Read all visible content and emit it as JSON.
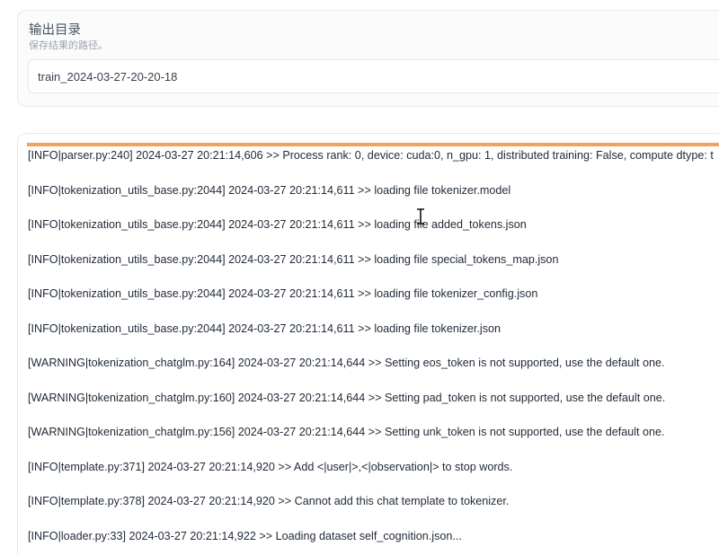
{
  "output_dir": {
    "label": "输出目录",
    "description": "保存结果的路径。",
    "value": "train_2024-03-27-20-20-18"
  },
  "log": {
    "progress_color": "#f4a15d",
    "lines": [
      "[INFO|parser.py:240] 2024-03-27 20:21:14,606 >> Process rank: 0, device: cuda:0, n_gpu: 1, distributed training: False, compute dtype: t",
      "[INFO|tokenization_utils_base.py:2044] 2024-03-27 20:21:14,611 >> loading file tokenizer.model",
      "[INFO|tokenization_utils_base.py:2044] 2024-03-27 20:21:14,611 >> loading file added_tokens.json",
      "[INFO|tokenization_utils_base.py:2044] 2024-03-27 20:21:14,611 >> loading file special_tokens_map.json",
      "[INFO|tokenization_utils_base.py:2044] 2024-03-27 20:21:14,611 >> loading file tokenizer_config.json",
      "[INFO|tokenization_utils_base.py:2044] 2024-03-27 20:21:14,611 >> loading file tokenizer.json",
      "[WARNING|tokenization_chatglm.py:164] 2024-03-27 20:21:14,644 >> Setting eos_token is not supported, use the default one.",
      "[WARNING|tokenization_chatglm.py:160] 2024-03-27 20:21:14,644 >> Setting pad_token is not supported, use the default one.",
      "[WARNING|tokenization_chatglm.py:156] 2024-03-27 20:21:14,644 >> Setting unk_token is not supported, use the default one.",
      "[INFO|template.py:371] 2024-03-27 20:21:14,920 >> Add <|user|>,<|observation|> to stop words.",
      "[INFO|template.py:378] 2024-03-27 20:21:14,920 >> Cannot add this chat template to tokenizer.",
      "[INFO|loader.py:33] 2024-03-27 20:21:14,922 >> Loading dataset self_cognition.json..."
    ]
  }
}
